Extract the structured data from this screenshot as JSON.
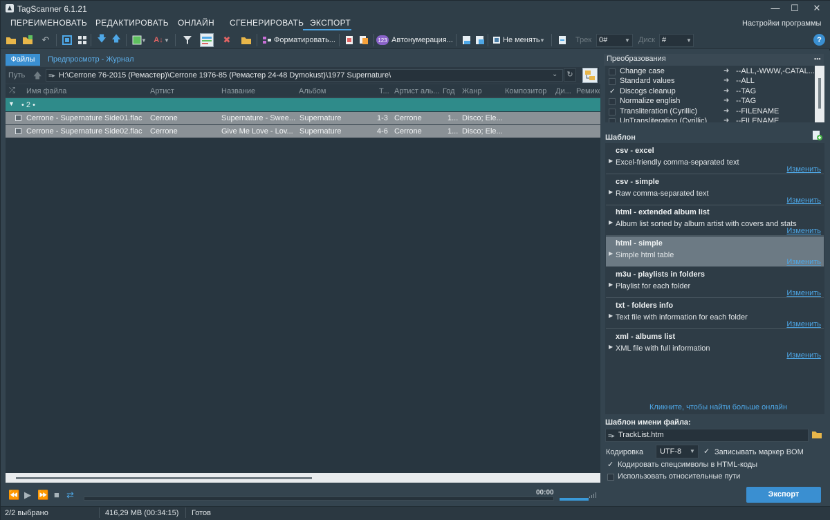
{
  "app": {
    "title": "TagScanner 6.1.21"
  },
  "window_controls": {
    "minimize": "—",
    "maximize": "☐",
    "close": "✕"
  },
  "menu": {
    "tabs": [
      "ПЕРЕИМЕНОВАТЬ",
      "РЕДАКТИРОВАТЬ",
      "ОНЛАЙН",
      "СГЕНЕРИРОВАТЬ",
      "ЭКСПОРТ"
    ],
    "active": "ЭКСПОРТ",
    "settings": "Настройки программы"
  },
  "toolbar": {
    "format_label": "Форматировать...",
    "autonumber_label": "Автонумерация...",
    "nochange_label": "Не менять",
    "track_label": "Трек",
    "track_value": "0#",
    "disc_label": "Диск",
    "disc_value": "#",
    "help": "?"
  },
  "left_tabs": {
    "files": "Файлы",
    "preview": "Предпросмотр - Журнал"
  },
  "path": {
    "label": "Путь",
    "value": "H:\\Cerrone 76-2015 (Ремастер)\\Cerrone 1976-85 (Ремастер 24-48 Dymokust)\\1977 Supernature\\"
  },
  "grid": {
    "columns": [
      "Имя файла",
      "Артист",
      "Название",
      "Альбом",
      "Т...",
      "Артист аль...",
      "Год",
      "Жанр",
      "Композитор",
      "Ди...",
      "Ремикс"
    ],
    "group_label": "• 2 •",
    "rows": [
      {
        "file": "Cerrone - Supernature Side01.flac",
        "artist": "Cerrone",
        "title": "Supernature - Swee...",
        "album": "Supernature",
        "track": "1-3",
        "album_artist": "Cerrone",
        "year": "1...",
        "genre": "Disco; Ele..."
      },
      {
        "file": "Cerrone - Supernature Side02.flac",
        "artist": "Cerrone",
        "title": "Give Me Love - Lov...",
        "album": "Supernature",
        "track": "4-6",
        "album_artist": "Cerrone",
        "year": "1...",
        "genre": "Disco; Ele..."
      }
    ]
  },
  "player": {
    "time": "00:00"
  },
  "status": {
    "selected": "2/2 выбрано",
    "size": "416,29 MB (00:34:15)",
    "state": "Готов"
  },
  "conversions": {
    "header": "Преобразования",
    "items": [
      {
        "name": "Change case",
        "value": "--ALL,-WWW,-CATAL...",
        "checked": false
      },
      {
        "name": "Standard values",
        "value": "--ALL",
        "checked": false
      },
      {
        "name": "Discogs cleanup",
        "value": "--TAG",
        "checked": true
      },
      {
        "name": "Normalize english",
        "value": "--TAG",
        "checked": false
      },
      {
        "name": "Transliteration (Cyrillic)",
        "value": "--FILENAME",
        "checked": false
      },
      {
        "name": "UnTransliteration (Cyrillic)",
        "value": "--FILENAME",
        "checked": false
      }
    ]
  },
  "templates": {
    "header": "Шаблон",
    "edit_label": "Изменить",
    "items": [
      {
        "title": "csv - excel",
        "desc": "Excel-friendly comma-separated text"
      },
      {
        "title": "csv - simple",
        "desc": "Raw comma-separated text"
      },
      {
        "title": "html - extended album list",
        "desc": "Album list sorted by album artist with covers and stats"
      },
      {
        "title": "html - simple",
        "desc": "Simple html table"
      },
      {
        "title": "m3u - playlists in folders",
        "desc": "Playlist for each folder"
      },
      {
        "title": "txt - folders info",
        "desc": "Text file with information for each folder"
      },
      {
        "title": "xml - albums list",
        "desc": "XML file with full information"
      }
    ],
    "selected_index": 3,
    "more_online": "Кликните, чтобы найти больше онлайн"
  },
  "filename": {
    "label": "Шаблон имени файла:",
    "value": "TrackList.htm"
  },
  "encoding": {
    "label": "Кодировка",
    "value": "UTF-8",
    "bom_label": "Записывать маркер BOM",
    "bom_checked": true
  },
  "options": {
    "html_codes_label": "Кодировать спецсимволы в HTML-коды",
    "html_codes_checked": true,
    "relative_paths_label": "Использовать относительные пути",
    "relative_paths_checked": false
  },
  "export_button": "Экспорт",
  "colors": {
    "accent": "#3a8fd1",
    "group_row": "#2f8b8a",
    "selected_row": "#8a9196",
    "link": "#4ea7e6"
  }
}
